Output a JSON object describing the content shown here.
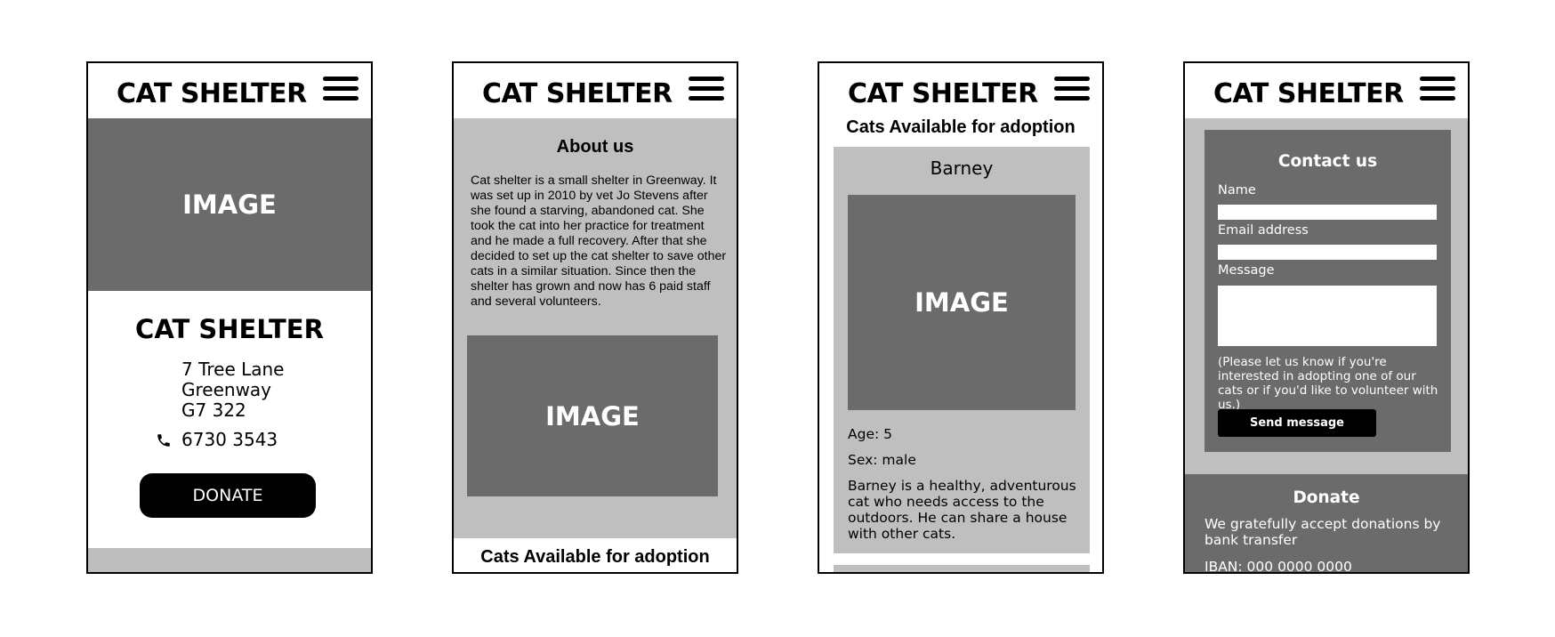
{
  "header": {
    "title": "CAT SHELTER"
  },
  "placeholder": {
    "image_label": "IMAGE"
  },
  "home": {
    "name": "CAT SHELTER",
    "address_lines": [
      "7 Tree Lane",
      "Greenway",
      "G7 322"
    ],
    "phone": "6730 3543",
    "donate_label": "DONATE"
  },
  "about": {
    "title": "About us",
    "text": "Cat shelter is a small shelter in Greenway. It was set up in 2010 by vet Jo Stevens after she found a starving, abandoned cat. She took the cat into her practice for treatment and he made a full recovery. After that she decided to set up the cat shelter to save other cats in a similar situation. Since then the shelter has grown and now has 6 paid staff and several volunteers.",
    "next_section_title": "Cats Available for adoption"
  },
  "adoption": {
    "title": "Cats Available for adoption",
    "cat": {
      "name": "Barney",
      "age": "Age: 5",
      "sex": "Sex: male",
      "description": "Barney is a healthy, adventurous cat who needs access to the outdoors. He can share a house with other cats."
    }
  },
  "contact": {
    "title": "Contact us",
    "name_label": "Name",
    "name_value": "",
    "email_label": "Email address",
    "email_value": "",
    "message_label": "Message",
    "message_value": "",
    "note": "(Please let us know if you're interested in adopting one of our cats or if you'd like to volunteer with us.)",
    "send_label": "Send message"
  },
  "donate": {
    "title": "Donate",
    "text": "We gratefully accept donations by bank transfer",
    "iban": "IBAN: 000 0000 0000"
  },
  "icons": {
    "menu": "hamburger-menu-icon",
    "phone": "phone-icon"
  },
  "colors": {
    "placeholder_dark": "#6b6b6b",
    "panel_light": "#bfbfbf",
    "button": "#000000"
  }
}
